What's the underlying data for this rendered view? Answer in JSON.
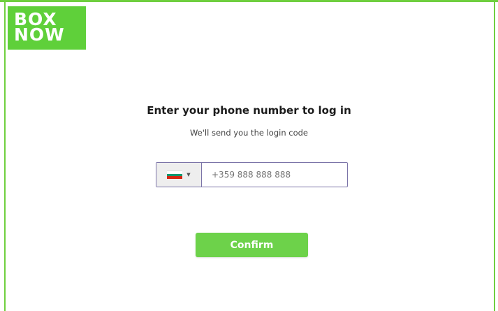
{
  "logo": {
    "line1": "BOX",
    "line2": "NOW"
  },
  "login": {
    "title": "Enter your phone number to log in",
    "subtitle": "We'll send you the login code"
  },
  "phone": {
    "country_flag": "flag-bulgaria-icon",
    "placeholder": "+359 888 888 888",
    "value": ""
  },
  "actions": {
    "confirm_label": "Confirm"
  },
  "colors": {
    "brand_green": "#5fd03a",
    "button_green": "#6dd24a",
    "input_border": "#7b74a8"
  }
}
